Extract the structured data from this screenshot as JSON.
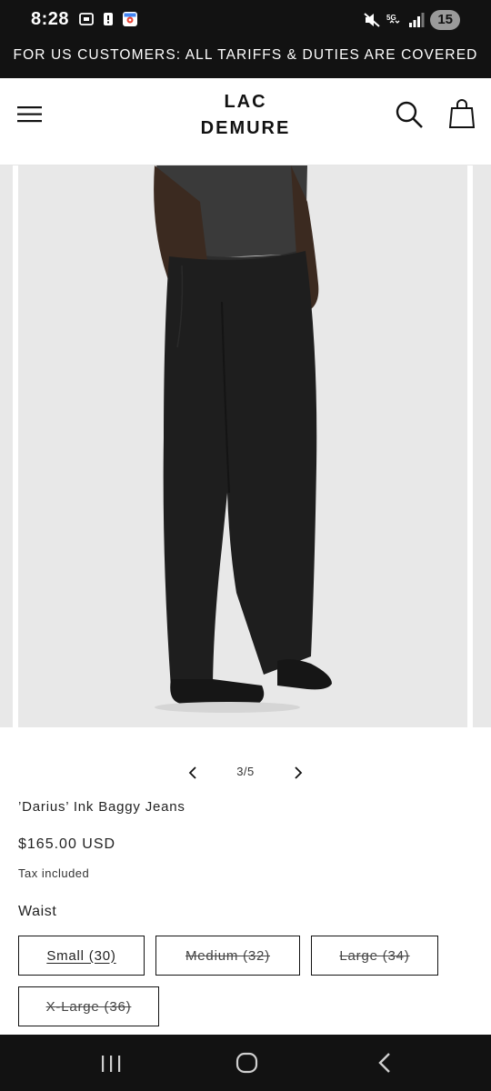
{
  "status_bar": {
    "time": "8:28",
    "battery": "15",
    "network": "5G"
  },
  "announcement": {
    "text": "FOR US CUSTOMERS: ALL TARIFFS & DUTIES ARE COVERED"
  },
  "header": {
    "logo_line1": "LAC",
    "logo_line2": "DEMURE",
    "menu_icon": "hamburger-icon",
    "search_icon": "search-icon",
    "cart_icon": "shopping-bag-icon"
  },
  "gallery": {
    "counter": "3/5",
    "background": "#e8e8e8"
  },
  "product": {
    "title": "’Darius’ Ink Baggy Jeans",
    "price": "$165.00 USD",
    "tax_note": "Tax included"
  },
  "variants": {
    "label": "Waist",
    "options": [
      {
        "label": "Small (30)",
        "available": true
      },
      {
        "label": "Medium (32)",
        "available": false
      },
      {
        "label": "Large (34)",
        "available": false
      },
      {
        "label": "X-Large (36)",
        "available": false
      }
    ]
  },
  "colors": {
    "bar": "#121212",
    "text": "#121212",
    "image_bg": "#e8e8e8"
  }
}
